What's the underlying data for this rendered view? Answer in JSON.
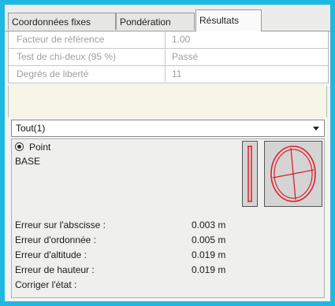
{
  "tabs": [
    {
      "label": "Coordonnées fixes"
    },
    {
      "label": "Pondération"
    },
    {
      "label": "Résultats"
    }
  ],
  "properties": [
    {
      "key": "Facteur de référence",
      "value": "1.00"
    },
    {
      "key": "Test de chi-deux (95 %)",
      "value": "Passé"
    },
    {
      "key": "Degrés de liberté",
      "value": "11"
    }
  ],
  "filter": {
    "selected": "Tout(1)"
  },
  "point": {
    "option_label": "Point",
    "name": "BASE"
  },
  "stats": [
    {
      "key": "Erreur sur l'abscisse :",
      "value": "0.003 m"
    },
    {
      "key": "Erreur d'ordonnée :",
      "value": "0.005 m"
    },
    {
      "key": "Erreur d'altitude :",
      "value": "0.019 m"
    },
    {
      "key": "Erreur de hauteur :",
      "value": "0.019 m"
    },
    {
      "key": "Corriger l'état :",
      "value": ""
    }
  ],
  "colors": {
    "accent_frame": "#1fb8e0",
    "ellipse_red": "#e0202a"
  },
  "icons": [
    "radio-selected-icon",
    "vertical-error-bar-icon",
    "error-ellipse-icon"
  ]
}
